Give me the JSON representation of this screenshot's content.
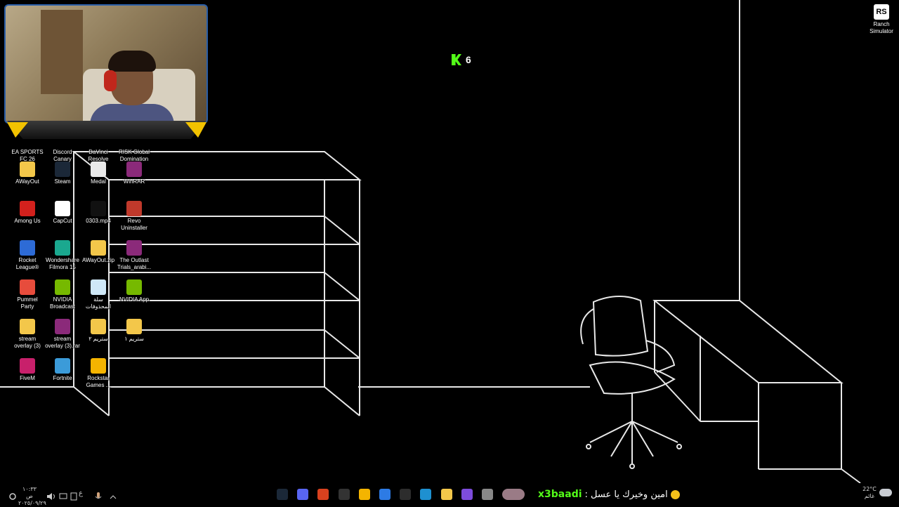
{
  "colors": {
    "background": "#000000",
    "kick_green": "#53fc18",
    "webcam_border": "#2a5ea8",
    "overlay_yellow": "#f2c200"
  },
  "kick": {
    "viewer_count": "6"
  },
  "desktop_icons": [
    {
      "label": "EA SPORTS FC 26",
      "icon": "ea-fc-icon",
      "color": "#1e1e1e"
    },
    {
      "label": "Discord Canary",
      "icon": "discord-icon",
      "color": "#5865f2"
    },
    {
      "label": "DaVinci Resolve",
      "icon": "davinci-icon",
      "color": "#2b2b2b"
    },
    {
      "label": "RISK Global Domination",
      "icon": "risk-icon",
      "color": "#7a1d1d"
    },
    {
      "label": "AWayOut",
      "icon": "folder-icon",
      "color": "#f3c74a"
    },
    {
      "label": "Steam",
      "icon": "steam-icon",
      "color": "#1b2838"
    },
    {
      "label": "Medal",
      "icon": "medal-icon",
      "color": "#e9e9e9"
    },
    {
      "label": "WinRAR",
      "icon": "winrar-icon",
      "color": "#8b2a7a"
    },
    {
      "label": "Among Us",
      "icon": "among-us-icon",
      "color": "#d3211d"
    },
    {
      "label": "CapCut",
      "icon": "capcut-icon",
      "color": "#ffffff"
    },
    {
      "label": "0303.mp4",
      "icon": "video-file-icon",
      "color": "#111111"
    },
    {
      "label": "Revo Uninstaller",
      "icon": "revo-icon",
      "color": "#c0392b"
    },
    {
      "label": "Rocket League®",
      "icon": "rocket-league-icon",
      "color": "#2d6bd6"
    },
    {
      "label": "Wondershare Filmora 15",
      "icon": "filmora-icon",
      "color": "#1aa88f"
    },
    {
      "label": "AWayOut.zip",
      "icon": "zip-folder-icon",
      "color": "#f3c74a"
    },
    {
      "label": "The Outlast Trials_arabi...",
      "icon": "winrar-icon",
      "color": "#8b2a7a"
    },
    {
      "label": "Pummel Party",
      "icon": "pummel-party-icon",
      "color": "#e74c3c"
    },
    {
      "label": "NVIDIA Broadcast",
      "icon": "nvidia-broadcast-icon",
      "color": "#76b900"
    },
    {
      "label": "سلة المحذوفات",
      "icon": "recycle-bin-icon",
      "color": "#cfe8f7"
    },
    {
      "label": "NVIDIA App",
      "icon": "nvidia-app-icon",
      "color": "#76b900"
    },
    {
      "label": "stream overlay (3)",
      "icon": "folder-icon",
      "color": "#f3c74a"
    },
    {
      "label": "stream overlay (3).rar",
      "icon": "winrar-icon",
      "color": "#8b2a7a"
    },
    {
      "label": "ستريم ٢",
      "icon": "folder-icon",
      "color": "#f3c74a"
    },
    {
      "label": "ستريم ١",
      "icon": "folder-icon",
      "color": "#f3c74a"
    },
    {
      "label": "FiveM",
      "icon": "fivem-icon",
      "color": "#c8206b"
    },
    {
      "label": "Fortnite",
      "icon": "fortnite-icon",
      "color": "#3b9bd9"
    },
    {
      "label": "Rockstar Games ...",
      "icon": "rockstar-icon",
      "color": "#f5b400"
    }
  ],
  "ranch": {
    "label": "Ranch Simulator",
    "icon_text": "RS"
  },
  "taskbar": {
    "time": "١٠:٣٣ ص",
    "date": "٢٠٢٥/٠٩/٢٩",
    "lang": "ع",
    "weather_temp": "22°C",
    "weather_text": "غائم",
    "apps": [
      {
        "icon": "steam-icon",
        "color": "#1b2838"
      },
      {
        "icon": "discord-icon",
        "color": "#5865f2"
      },
      {
        "icon": "obs-icon",
        "color": "#d9411e"
      },
      {
        "icon": "obs-alt-icon",
        "color": "#333333"
      },
      {
        "icon": "chrome-icon",
        "color": "#f4b400"
      },
      {
        "icon": "mail-icon",
        "color": "#2d7be5"
      },
      {
        "icon": "calculator-icon",
        "color": "#2d2d2d"
      },
      {
        "icon": "edge-icon",
        "color": "#1e90d0"
      },
      {
        "icon": "file-explorer-icon",
        "color": "#f3c74a"
      },
      {
        "icon": "visual-studio-icon",
        "color": "#7d4cdb"
      },
      {
        "icon": "window-icon",
        "color": "#888888"
      },
      {
        "icon": "thumbnail-icon",
        "color": "#9a7b86"
      }
    ]
  },
  "chat": {
    "username": "x3baadi",
    "message": ": امين وخيرك يا عسل"
  }
}
